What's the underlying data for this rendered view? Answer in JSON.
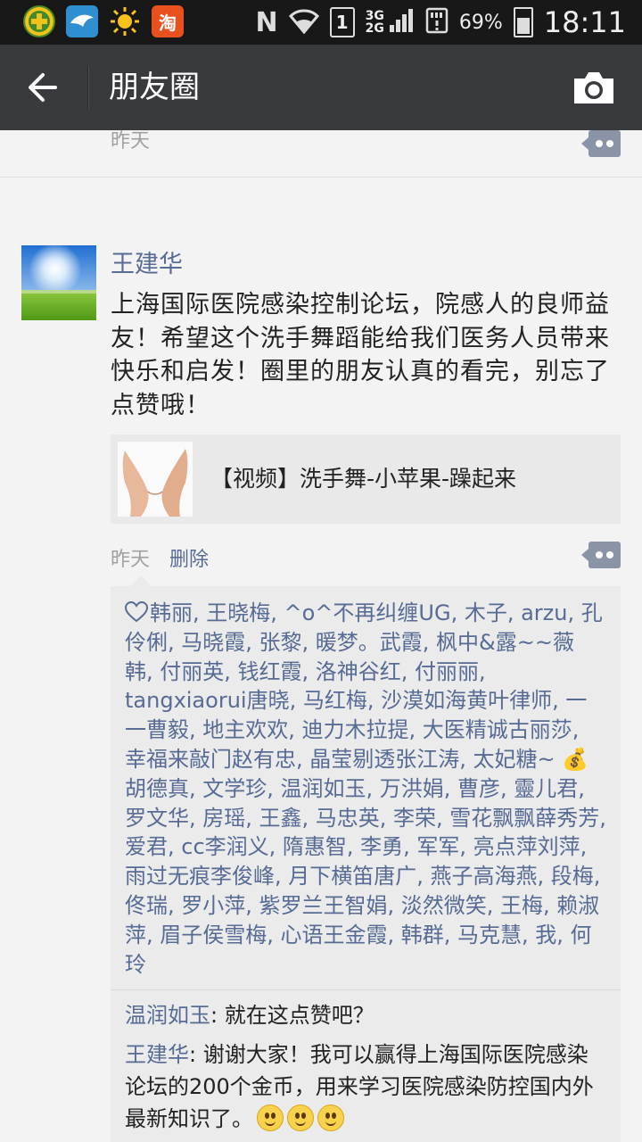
{
  "status_bar": {
    "app_icons": [
      "app-plus-icon",
      "bird-app-icon",
      "sun-icon",
      "taobao-icon"
    ],
    "taobao_label": "淘",
    "nfc_label": "N",
    "sim_label": "1",
    "network_3g": "3G",
    "network_2g": "2G",
    "battery_percent": "69%",
    "time": "18:11"
  },
  "header": {
    "title": "朋友圈"
  },
  "previous_post": {
    "time": "昨天"
  },
  "post": {
    "author": "王建华",
    "text": "上海国际医院感染控制论坛，院感人的良师益友！希望这个洗手舞蹈能给我们医务人员带来快乐和启发！圈里的朋友认真的看完，别忘了点赞哦！",
    "link_title": "【视频】洗手舞-小苹果-躁起来",
    "time": "昨天",
    "delete_label": "删除",
    "likes_part1": "韩丽, 王晓梅, ^o^不再纠缠UG, 木子, arzu, 孔伶俐, 马晓霞, 张黎, 暖梦。武霞, 枫中&露~~薇　韩, 付丽英, 钱红霞, 洛神谷红, 付丽丽, tangxiaorui唐晓, 马红梅, 沙漠如海黄叶律师, 一一曹毅, 地主欢欢, 迪力木拉提, 大医精诚古丽莎, 幸福来敲门赵有忠, 晶莹剔透张江涛, 太妃糖~ ",
    "likes_part2": "胡德真, 文学珍, 温润如玉, 万洪娟, 曹彦, 靈儿君, 罗文华, 房瑶, 王鑫, 马忠英, 李荣, 雪花飘飘薛秀芳, 爱君, cc李润义, 隋惠智, 李勇, 军军, 亮点萍刘萍, 雨过无痕李俊峰, 月下横笛唐广, 燕子高海燕, 段梅, 佟瑞, 罗小萍, 紫罗兰王智娟, 淡然微笑, 王梅, 赖淑萍, 眉子侯雪梅, 心语王金霞, 韩群, 马克慧, 我, 何玲",
    "likes_emoji": "💰",
    "comments": [
      {
        "name": "温润如玉",
        "sep": ": ",
        "text": "就在这点赞吧？"
      },
      {
        "name": "王建华",
        "sep": ": ",
        "text": "谢谢大家！我可以赢得上海国际医院感染论坛的200个金币，用来学习医院感染防控国内外最新知识了。"
      }
    ]
  },
  "colors": {
    "title_bar": "#393a3e",
    "status_bar": "#181818",
    "link_blue": "#576b95",
    "background": "#f3f3f3"
  }
}
